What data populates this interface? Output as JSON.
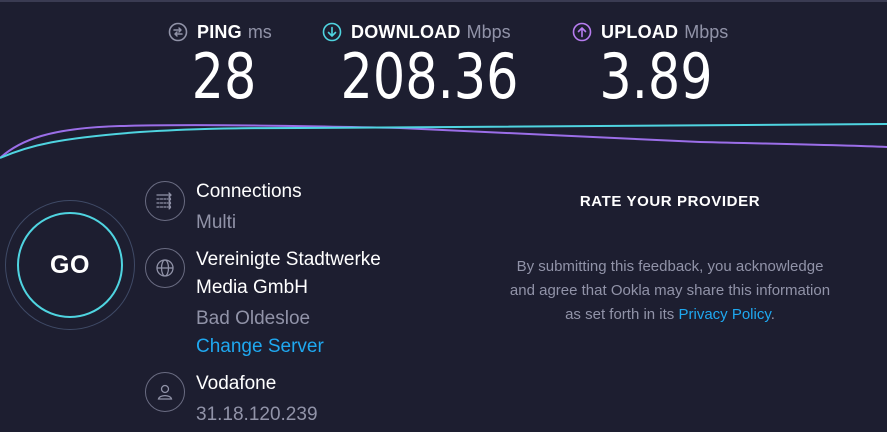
{
  "metrics": {
    "ping": {
      "label": "PING",
      "unit": "ms",
      "value": "28",
      "icon": "ping-icon",
      "color": "#9193a8"
    },
    "download": {
      "label": "DOWNLOAD",
      "unit": "Mbps",
      "value": "208.36",
      "icon": "download-arrow-icon",
      "color": "#4fd4e0"
    },
    "upload": {
      "label": "UPLOAD",
      "unit": "Mbps",
      "value": "3.89",
      "icon": "upload-arrow-icon",
      "color": "#b77cf0"
    }
  },
  "graph": {
    "download_color": "#4fd4e0",
    "upload_color": "#9b6ee8"
  },
  "go_button": {
    "label": "GO",
    "ring_color": "#4fd4e0"
  },
  "connections": {
    "title": "Connections",
    "value": "Multi",
    "icon": "connections-icon"
  },
  "server": {
    "name_line1": "Vereinigte Stadtwerke",
    "name_line2": "Media GmbH",
    "location": "Bad Oldesloe",
    "change_label": "Change Server",
    "icon": "globe-icon"
  },
  "isp": {
    "name": "Vodafone",
    "ip": "31.18.120.239",
    "icon": "user-icon"
  },
  "rate": {
    "title": "RATE YOUR PROVIDER",
    "text_line1": "By submitting this feedback, you acknowledge",
    "text_line2": "and agree that Ookla may share this information",
    "text_line3": "as set forth in its",
    "privacy_link": "Privacy Policy",
    "period": "."
  },
  "colors": {
    "background": "#1d1e30",
    "link": "#1fa8f0",
    "muted": "#9193a8"
  }
}
